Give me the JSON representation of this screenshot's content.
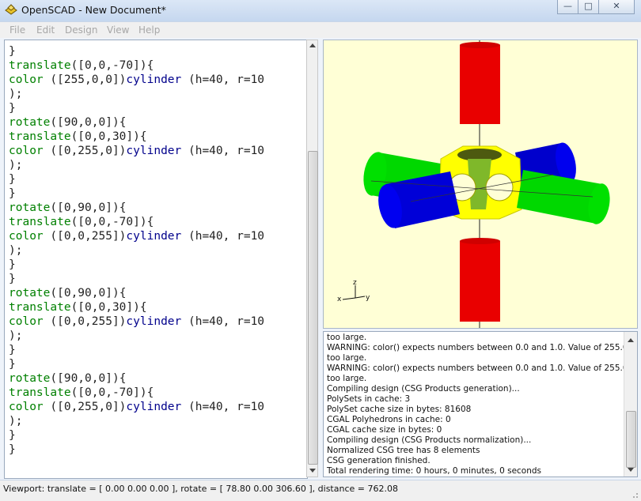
{
  "window": {
    "title": "OpenSCAD - New Document*"
  },
  "menu": [
    "File",
    "Edit",
    "Design",
    "View",
    "Help"
  ],
  "editor": {
    "lines": [
      [
        [
          "}",
          "#222"
        ]
      ],
      [
        [
          "translate",
          "#008000"
        ],
        [
          "([0,0,-70]){",
          "#222"
        ]
      ],
      [
        [
          "color",
          "#008000"
        ],
        [
          " ([255,0,0])",
          "#222"
        ],
        [
          "cylinder",
          "#00008b"
        ],
        [
          " (h=40, r=10",
          "#222"
        ]
      ],
      [
        [
          ");",
          "#222"
        ]
      ],
      [
        [
          "}",
          "#222"
        ]
      ],
      [
        [
          "rotate",
          "#008000"
        ],
        [
          "([90,0,0]){",
          "#222"
        ]
      ],
      [
        [
          "translate",
          "#008000"
        ],
        [
          "([0,0,30]){",
          "#222"
        ]
      ],
      [
        [
          "color",
          "#008000"
        ],
        [
          " ([0,255,0])",
          "#222"
        ],
        [
          "cylinder",
          "#00008b"
        ],
        [
          " (h=40, r=10",
          "#222"
        ]
      ],
      [
        [
          ");",
          "#222"
        ]
      ],
      [
        [
          "}",
          "#222"
        ]
      ],
      [
        [
          "}",
          "#222"
        ]
      ],
      [
        [
          "rotate",
          "#008000"
        ],
        [
          "([0,90,0]){",
          "#222"
        ]
      ],
      [
        [
          "translate",
          "#008000"
        ],
        [
          "([0,0,-70]){",
          "#222"
        ]
      ],
      [
        [
          "color",
          "#008000"
        ],
        [
          " ([0,0,255])",
          "#222"
        ],
        [
          "cylinder",
          "#00008b"
        ],
        [
          " (h=40, r=10",
          "#222"
        ]
      ],
      [
        [
          ");",
          "#222"
        ]
      ],
      [
        [
          "}",
          "#222"
        ]
      ],
      [
        [
          "}",
          "#222"
        ]
      ],
      [
        [
          "rotate",
          "#008000"
        ],
        [
          "([0,90,0]){",
          "#222"
        ]
      ],
      [
        [
          "translate",
          "#008000"
        ],
        [
          "([0,0,30]){",
          "#222"
        ]
      ],
      [
        [
          "color",
          "#008000"
        ],
        [
          " ([0,0,255])",
          "#222"
        ],
        [
          "cylinder",
          "#00008b"
        ],
        [
          " (h=40, r=10",
          "#222"
        ]
      ],
      [
        [
          ");",
          "#222"
        ]
      ],
      [
        [
          "}",
          "#222"
        ]
      ],
      [
        [
          "}",
          "#222"
        ]
      ],
      [
        [
          "rotate",
          "#008000"
        ],
        [
          "([90,0,0]){",
          "#222"
        ]
      ],
      [
        [
          "translate",
          "#008000"
        ],
        [
          "([0,0,-70]){",
          "#222"
        ]
      ],
      [
        [
          "color",
          "#008000"
        ],
        [
          " ([0,255,0])",
          "#222"
        ],
        [
          "cylinder",
          "#00008b"
        ],
        [
          " (h=40, r=10",
          "#222"
        ]
      ],
      [
        [
          ");",
          "#222"
        ]
      ],
      [
        [
          "}",
          "#222"
        ]
      ],
      [
        [
          "}",
          "#222"
        ]
      ]
    ]
  },
  "viewport": {
    "axis_labels": {
      "x": "x",
      "y": "y",
      "z": "z"
    }
  },
  "console": {
    "lines": [
      "too large.",
      "WARNING: color() expects numbers between 0.0 and 1.0. Value of 255.0 is",
      "too large.",
      "WARNING: color() expects numbers between 0.0 and 1.0. Value of 255.0 is",
      "too large.",
      "Compiling design (CSG Products generation)...",
      "PolySets in cache: 3",
      "PolySet cache size in bytes: 81608",
      "CGAL Polyhedrons in cache: 0",
      "CGAL cache size in bytes: 0",
      "Compiling design (CSG Products normalization)...",
      "Normalized CSG tree has 8 elements",
      "CSG generation finished.",
      "Total rendering time: 0 hours, 0 minutes, 0 seconds"
    ]
  },
  "status": {
    "text": "Viewport: translate = [ 0.00 0.00 0.00 ], rotate = [ 78.80 0.00 306.60 ], distance = 762.08"
  }
}
